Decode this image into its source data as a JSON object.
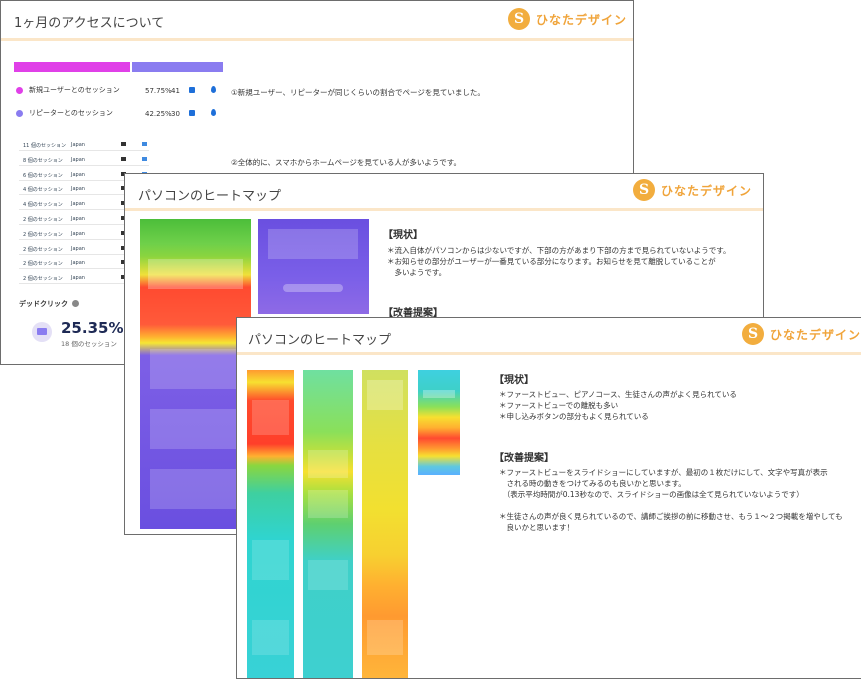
{
  "card1": {
    "title": "1ヶ月のアクセスについて",
    "logo_text": "ひなたデザイン",
    "legend": [
      {
        "label": "新規ユーザーとのセッション",
        "percent": "57.75%",
        "count": "41",
        "color": "#e040e8"
      },
      {
        "label": "リピーターとのセッション",
        "percent": "42.25%",
        "count": "30",
        "color": "#8a7cf0"
      }
    ],
    "bar_split": 0.5775,
    "note1": "①新規ユーザー、リピーターが同じくらいの割合でページを見ていました。",
    "note2": "②全体的に、スマホからホームページを見ている人が多いようです。",
    "sessions": [
      {
        "label": "11 個のセッション",
        "country": "Japan"
      },
      {
        "label": "8 個のセッション",
        "country": "Japan"
      },
      {
        "label": "6 個のセッション",
        "country": "Japan"
      },
      {
        "label": "4 個のセッション",
        "country": "Japan"
      },
      {
        "label": "4 個のセッション",
        "country": "Japan"
      },
      {
        "label": "2 個のセッション",
        "country": "Japan"
      },
      {
        "label": "2 個のセッション",
        "country": "Japan"
      },
      {
        "label": "2 個のセッション",
        "country": "Japan"
      },
      {
        "label": "2 個のセッション",
        "country": "Japan"
      },
      {
        "label": "2 個のセッション",
        "country": "Japan"
      }
    ],
    "dead_click_label": "デッドクリック",
    "dead_click_value": "25.35%",
    "dead_click_sub": "18 個のセッション"
  },
  "card2": {
    "title": "パソコンのヒートマップ",
    "logo_text": "ひなたデザイン",
    "status_heading": "【現状】",
    "status_items": [
      "＊流入自体がパソコンからは少ないですが、下部の方があまり下部の方まで見られていないようです。",
      "＊お知らせの部分がユーザーが一番見ている部分になります。お知らせを見て離脱していることが",
      "　多いようです。"
    ],
    "proposal_heading": "【改善提案】"
  },
  "card3": {
    "title": "パソコンのヒートマップ",
    "logo_text": "ひなたデザイン",
    "status_heading": "【現状】",
    "status_items": [
      "＊ファーストビュー、ピアノコース、生徒さんの声がよく見られている",
      "＊ファーストビューでの離脱も多い",
      "＊申し込みボタンの部分もよく見られている"
    ],
    "proposal_heading": "【改善提案】",
    "proposal_items": [
      "＊ファーストビューをスライドショーにしていますが、最初の１枚だけにして、文字や写真が表示",
      "　される時の動きをつけてみるのも良いかと思います。",
      "　（表示平均時間が0.13秒なので、スライドショーの画像は全て見られていないようです）",
      "",
      "＊生徒さんの声が良く見られているので、講師ご挨拶の前に移動させ、もう１～２つ掲載を増やしても",
      "　良いかと思います！"
    ]
  }
}
